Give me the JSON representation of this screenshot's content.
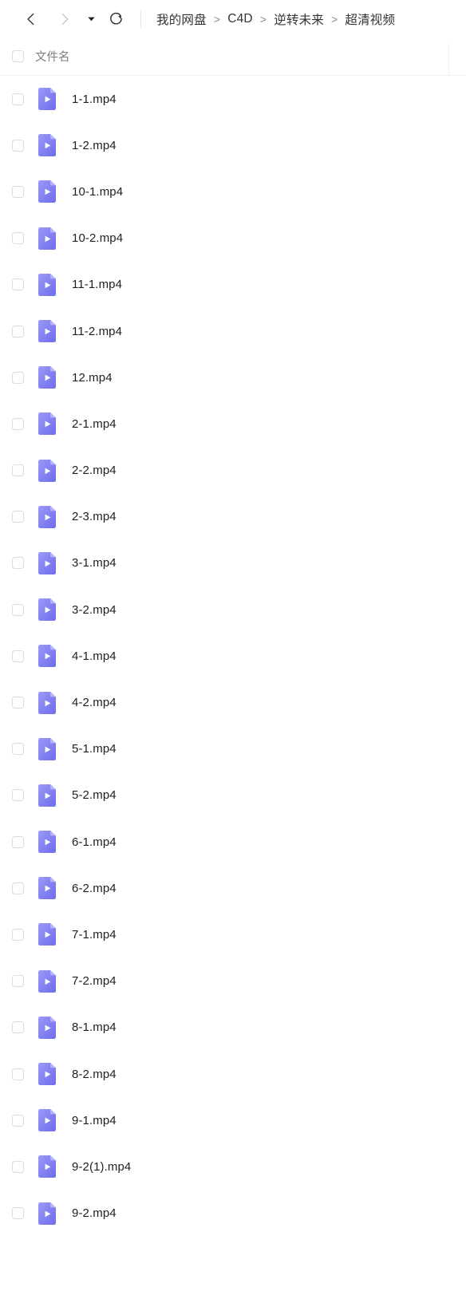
{
  "toolbar": {
    "back_label": "后退",
    "forward_label": "前进",
    "history_label": "历史记录",
    "refresh_label": "刷新",
    "icons": {
      "back": "chevron-left-icon",
      "forward": "chevron-right-icon",
      "caret": "caret-down-icon",
      "refresh": "refresh-icon"
    },
    "colors": {
      "back_enabled": "#3a3a3c",
      "forward_disabled": "#c9c9cd",
      "divider": "#e3e3e5"
    }
  },
  "breadcrumb": {
    "separator": ">",
    "items": [
      {
        "label": "我的网盘"
      },
      {
        "label": "C4D"
      },
      {
        "label": "逆转未来"
      },
      {
        "label": "超清视频"
      }
    ]
  },
  "list": {
    "header": {
      "select_all_checked": false,
      "columns": [
        {
          "label": "文件名"
        }
      ]
    },
    "accent_color": "#7b79f0",
    "icon_name": "video-file-icon",
    "rows": [
      {
        "name": "1-1.mp4",
        "checked": false
      },
      {
        "name": "1-2.mp4",
        "checked": false
      },
      {
        "name": "10-1.mp4",
        "checked": false
      },
      {
        "name": "10-2.mp4",
        "checked": false
      },
      {
        "name": "11-1.mp4",
        "checked": false
      },
      {
        "name": "11-2.mp4",
        "checked": false
      },
      {
        "name": "12.mp4",
        "checked": false
      },
      {
        "name": "2-1.mp4",
        "checked": false
      },
      {
        "name": "2-2.mp4",
        "checked": false
      },
      {
        "name": "2-3.mp4",
        "checked": false
      },
      {
        "name": "3-1.mp4",
        "checked": false
      },
      {
        "name": "3-2.mp4",
        "checked": false
      },
      {
        "name": "4-1.mp4",
        "checked": false
      },
      {
        "name": "4-2.mp4",
        "checked": false
      },
      {
        "name": "5-1.mp4",
        "checked": false
      },
      {
        "name": "5-2.mp4",
        "checked": false
      },
      {
        "name": "6-1.mp4",
        "checked": false
      },
      {
        "name": "6-2.mp4",
        "checked": false
      },
      {
        "name": "7-1.mp4",
        "checked": false
      },
      {
        "name": "7-2.mp4",
        "checked": false
      },
      {
        "name": "8-1.mp4",
        "checked": false
      },
      {
        "name": "8-2.mp4",
        "checked": false
      },
      {
        "name": "9-1.mp4",
        "checked": false
      },
      {
        "name": "9-2(1).mp4",
        "checked": false
      },
      {
        "name": "9-2.mp4",
        "checked": false
      }
    ]
  }
}
